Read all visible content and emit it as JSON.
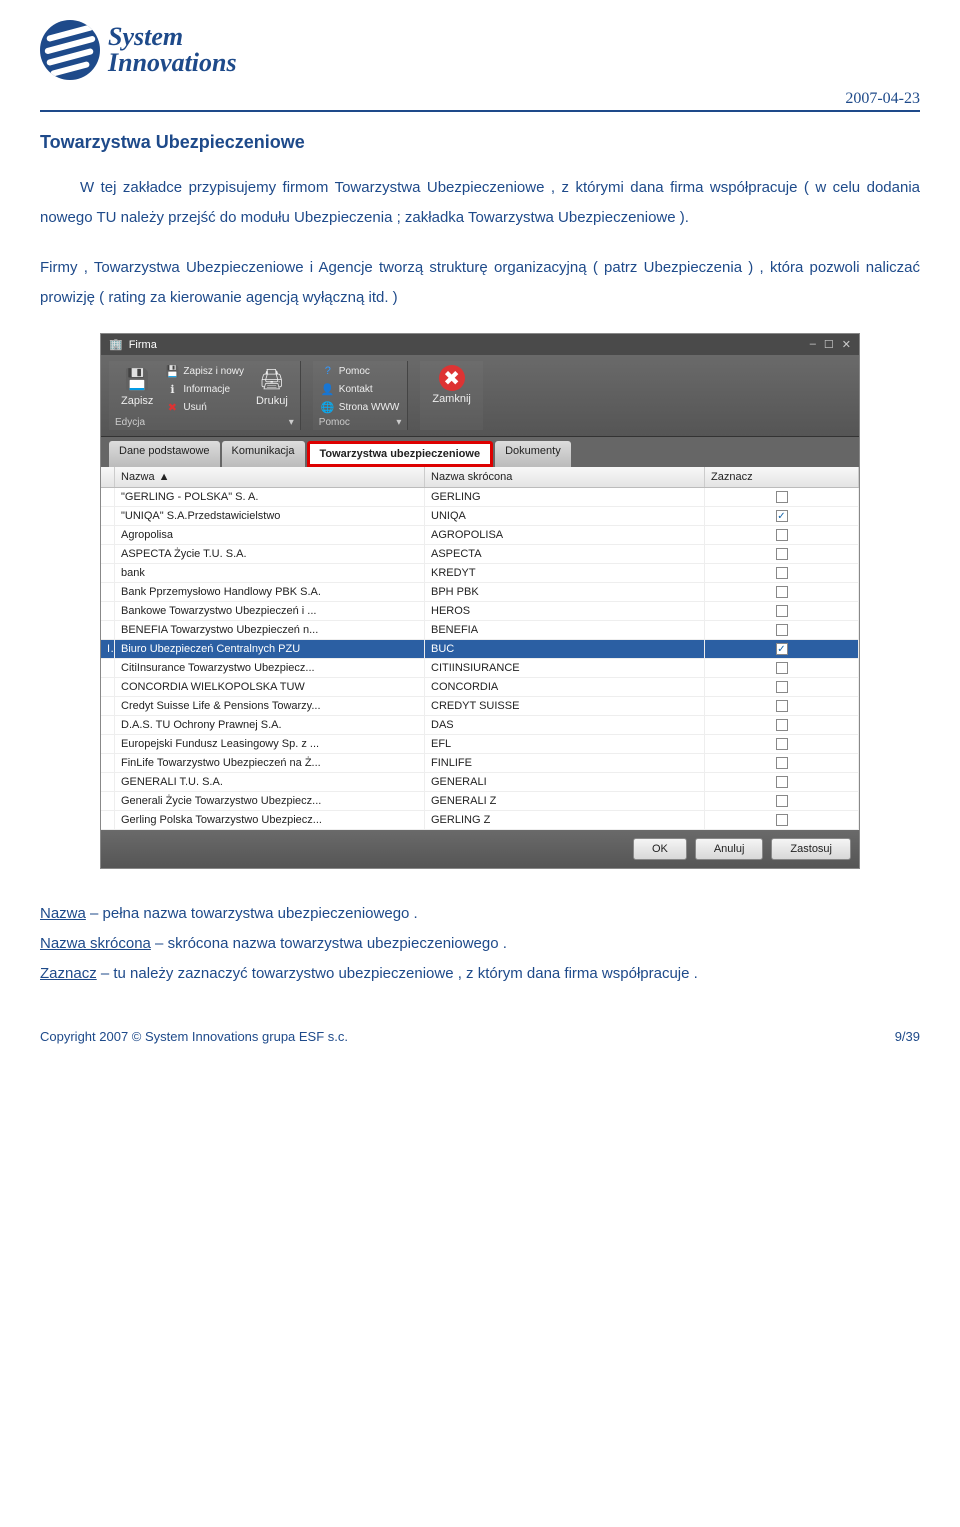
{
  "header": {
    "logo_line1": "System",
    "logo_line2": "Innovations",
    "date": "2007-04-23"
  },
  "section_title": "Towarzystwa Ubezpieczeniowe",
  "paragraph1": "W tej zakładce przypisujemy firmom Towarzystwa Ubezpieczeniowe , z którymi dana firma współpracuje ( w celu dodania nowego TU należy przejść do modułu Ubezpieczenia ; zakładka Towarzystwa Ubezpieczeniowe ).",
  "paragraph2": "Firmy , Towarzystwa Ubezpieczeniowe i Agencje tworzą strukturę organizacyjną ( patrz Ubezpieczenia ) , która pozwoli naliczać prowizję ( rating za kierowanie agencją wyłączną itd. )",
  "app": {
    "title": "Firma",
    "ribbon": {
      "zapisz": "Zapisz",
      "zapisz_nowy": "Zapisz i nowy",
      "informacje": "Informacje",
      "usun": "Usuń",
      "drukuj": "Drukuj",
      "pomoc": "Pomoc",
      "kontakt": "Kontakt",
      "strona_www": "Strona WWW",
      "zamknij": "Zamknij",
      "group_edycja": "Edycja",
      "group_pomoc": "Pomoc"
    },
    "tabs": [
      "Dane podstawowe",
      "Komunikacja",
      "Towarzystwa ubezpieczeniowe",
      "Dokumenty"
    ],
    "columns": {
      "col1": "Nazwa",
      "col2": "Nazwa skrócona",
      "col3": "Zaznacz"
    },
    "rows": [
      {
        "n": "\"GERLING - POLSKA\" S. A.",
        "s": "GERLING",
        "c": false,
        "sel": false
      },
      {
        "n": "\"UNIQA\" S.A.Przedstawicielstwo",
        "s": "UNIQA",
        "c": true,
        "sel": false
      },
      {
        "n": "Agropolisa",
        "s": "AGROPOLISA",
        "c": false,
        "sel": false
      },
      {
        "n": "ASPECTA Życie T.U. S.A.",
        "s": "ASPECTA",
        "c": false,
        "sel": false
      },
      {
        "n": "bank",
        "s": "KREDYT",
        "c": false,
        "sel": false
      },
      {
        "n": "Bank Pprzemysłowo Handlowy PBK S.A.",
        "s": "BPH PBK",
        "c": false,
        "sel": false
      },
      {
        "n": "Bankowe Towarzystwo Ubezpieczeń i ...",
        "s": "HEROS",
        "c": false,
        "sel": false
      },
      {
        "n": "BENEFIA Towarzystwo Ubezpieczeń n...",
        "s": "BENEFIA",
        "c": false,
        "sel": false
      },
      {
        "n": "Biuro Ubezpieczeń Centralnych PZU",
        "s": "BUC",
        "c": true,
        "sel": true
      },
      {
        "n": "CitiInsurance Towarzystwo Ubezpiecz...",
        "s": "CITIINSIURANCE",
        "c": false,
        "sel": false
      },
      {
        "n": "CONCORDIA WIELKOPOLSKA TUW",
        "s": "CONCORDIA",
        "c": false,
        "sel": false
      },
      {
        "n": "Credyt Suisse Life & Pensions Towarzy...",
        "s": "CREDYT SUISSE",
        "c": false,
        "sel": false
      },
      {
        "n": "D.A.S. TU Ochrony Prawnej S.A.",
        "s": "DAS",
        "c": false,
        "sel": false
      },
      {
        "n": "Europejski Fundusz Leasingowy Sp. z ...",
        "s": "EFL",
        "c": false,
        "sel": false
      },
      {
        "n": "FinLife Towarzystwo Ubezpieczeń na Ż...",
        "s": "FINLIFE",
        "c": false,
        "sel": false
      },
      {
        "n": "GENERALI T.U. S.A.",
        "s": "GENERALI",
        "c": false,
        "sel": false
      },
      {
        "n": "Generali Życie Towarzystwo Ubezpiecz...",
        "s": "GENERALI Z",
        "c": false,
        "sel": false
      },
      {
        "n": "Gerling Polska Towarzystwo Ubezpiecz...",
        "s": "GERLING Z",
        "c": false,
        "sel": false
      }
    ],
    "buttons": {
      "ok": "OK",
      "anuluj": "Anuluj",
      "zastosuj": "Zastosuj"
    }
  },
  "defs": {
    "nazwa_label": "Nazwa",
    "nazwa_text": " – pełna nazwa towarzystwa ubezpieczeniowego .",
    "skrocona_label": "Nazwa skrócona",
    "skrocona_text": " – skrócona nazwa towarzystwa ubezpieczeniowego .",
    "zaznacz_label": "Zaznacz",
    "zaznacz_text": " – tu należy zaznaczyć towarzystwo ubezpieczeniowe , z którym dana firma współpracuje ."
  },
  "footer": {
    "copyright": "Copyright 2007 © System Innovations grupa ESF s.c.",
    "page": "9/39"
  }
}
